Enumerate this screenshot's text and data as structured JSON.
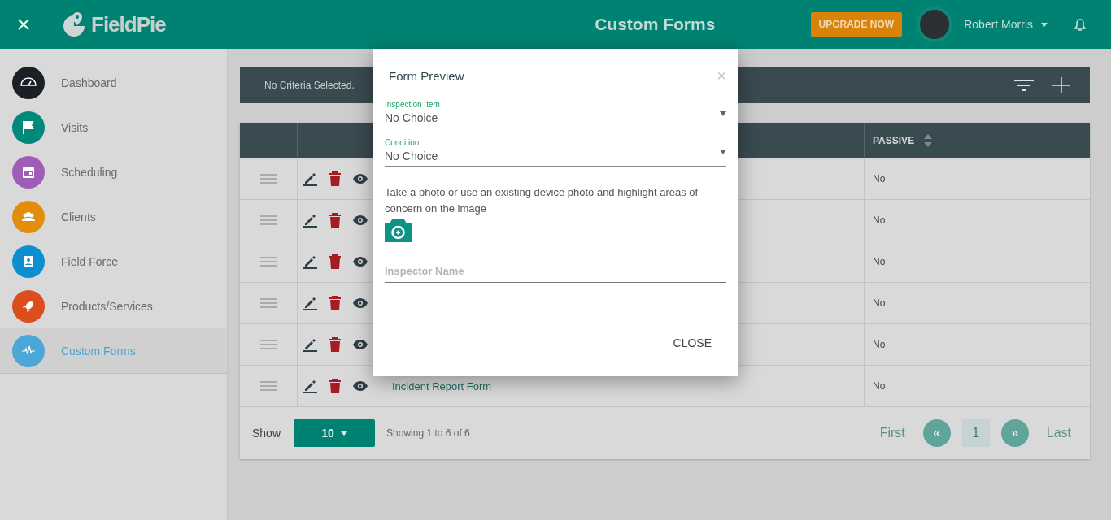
{
  "header": {
    "close_icon": "×",
    "brand": "FieldPie",
    "title": "Custom Forms",
    "upgrade_button": "UPGRADE NOW",
    "user_name": "Robert Morris"
  },
  "sidebar": {
    "items": [
      {
        "label": "Dashboard",
        "kind": "gauge",
        "color": "#1b2026",
        "selected": false
      },
      {
        "label": "Visits",
        "kind": "flag",
        "color": "#00897b",
        "selected": false
      },
      {
        "label": "Scheduling",
        "kind": "calendar",
        "color": "#a05db8",
        "selected": false
      },
      {
        "label": "Clients",
        "kind": "people",
        "color": "#e38d0c",
        "selected": false
      },
      {
        "label": "Field Force",
        "kind": "badge",
        "color": "#0b8fd1",
        "selected": false
      },
      {
        "label": "Products/Services",
        "kind": "rocket",
        "color": "#dd4e1c",
        "selected": false
      },
      {
        "label": "Custom Forms",
        "kind": "pulse",
        "color": "#4aa7d6",
        "selected": true
      }
    ]
  },
  "criteria": "No Criteria Selected.",
  "table": {
    "columns": [
      {
        "label": "PASSIVE",
        "sortable": true
      }
    ],
    "rows": [
      {
        "passive": "No"
      },
      {
        "passive": "No"
      },
      {
        "passive": "No"
      },
      {
        "passive": "No"
      },
      {
        "passive": "No"
      },
      {
        "name": "Incident Report Form",
        "passive": "No"
      }
    ]
  },
  "footer": {
    "show_label": "Show",
    "page_size": "10",
    "summary": "Showing 1 to 6 of 6",
    "pagination": {
      "first": "First",
      "prev": "«",
      "page": "1",
      "next": "»",
      "last": "Last"
    }
  },
  "dialog": {
    "title": "Form Preview",
    "close": "×",
    "fields": [
      {
        "kind": "select",
        "label": "Inspection Item",
        "value": "No Choice"
      },
      {
        "kind": "select",
        "label": "Condition",
        "value": "No Choice"
      },
      {
        "kind": "photo",
        "text": "Take a photo or use an existing device photo and highlight areas of concern on the image"
      },
      {
        "kind": "text",
        "placeholder": "Inspector Name"
      }
    ],
    "button": "CLOSE"
  }
}
